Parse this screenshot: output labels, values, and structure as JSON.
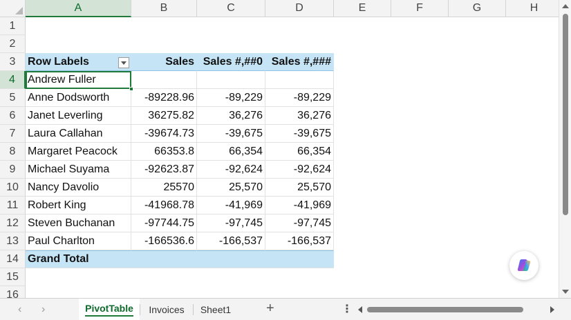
{
  "columns": [
    "A",
    "B",
    "C",
    "D",
    "E",
    "F",
    "G",
    "H"
  ],
  "rows": [
    "1",
    "2",
    "3",
    "4",
    "5",
    "6",
    "7",
    "8",
    "9",
    "10",
    "11",
    "12",
    "13",
    "14",
    "15",
    "16"
  ],
  "pivot": {
    "row_labels_header": "Row Labels",
    "col_b_header": "Sales",
    "col_c_header": "Sales #,##0",
    "col_d_header": "Sales #,###",
    "grand_total_label": "Grand Total",
    "records": [
      {
        "name": "Andrew Fuller",
        "b": "",
        "c": "",
        "d": ""
      },
      {
        "name": "Anne Dodsworth",
        "b": "-89228.96",
        "c": "-89,229",
        "d": "-89,229"
      },
      {
        "name": "Janet Leverling",
        "b": "36275.82",
        "c": "36,276",
        "d": "36,276"
      },
      {
        "name": "Laura Callahan",
        "b": "-39674.73",
        "c": "-39,675",
        "d": "-39,675"
      },
      {
        "name": "Margaret Peacock",
        "b": "66353.8",
        "c": "66,354",
        "d": "66,354"
      },
      {
        "name": "Michael Suyama",
        "b": "-92623.87",
        "c": "-92,624",
        "d": "-92,624"
      },
      {
        "name": "Nancy Davolio",
        "b": "25570",
        "c": "25,570",
        "d": "25,570"
      },
      {
        "name": "Robert King",
        "b": "-41968.78",
        "c": "-41,969",
        "d": "-41,969"
      },
      {
        "name": "Steven Buchanan",
        "b": "-97744.75",
        "c": "-97,745",
        "d": "-97,745"
      },
      {
        "name": "Paul Charlton",
        "b": "-166536.6",
        "c": "-166,537",
        "d": "-166,537"
      }
    ]
  },
  "sheet_tabs": {
    "tab1": "PivotTable",
    "tab2": "Invoices",
    "tab3": "Sheet1",
    "add": "+",
    "nav_prev": "‹",
    "nav_next": "›",
    "more": "⋮"
  },
  "accent_color": "#1f7a3a",
  "pivot_header_color": "#c5e4f5"
}
